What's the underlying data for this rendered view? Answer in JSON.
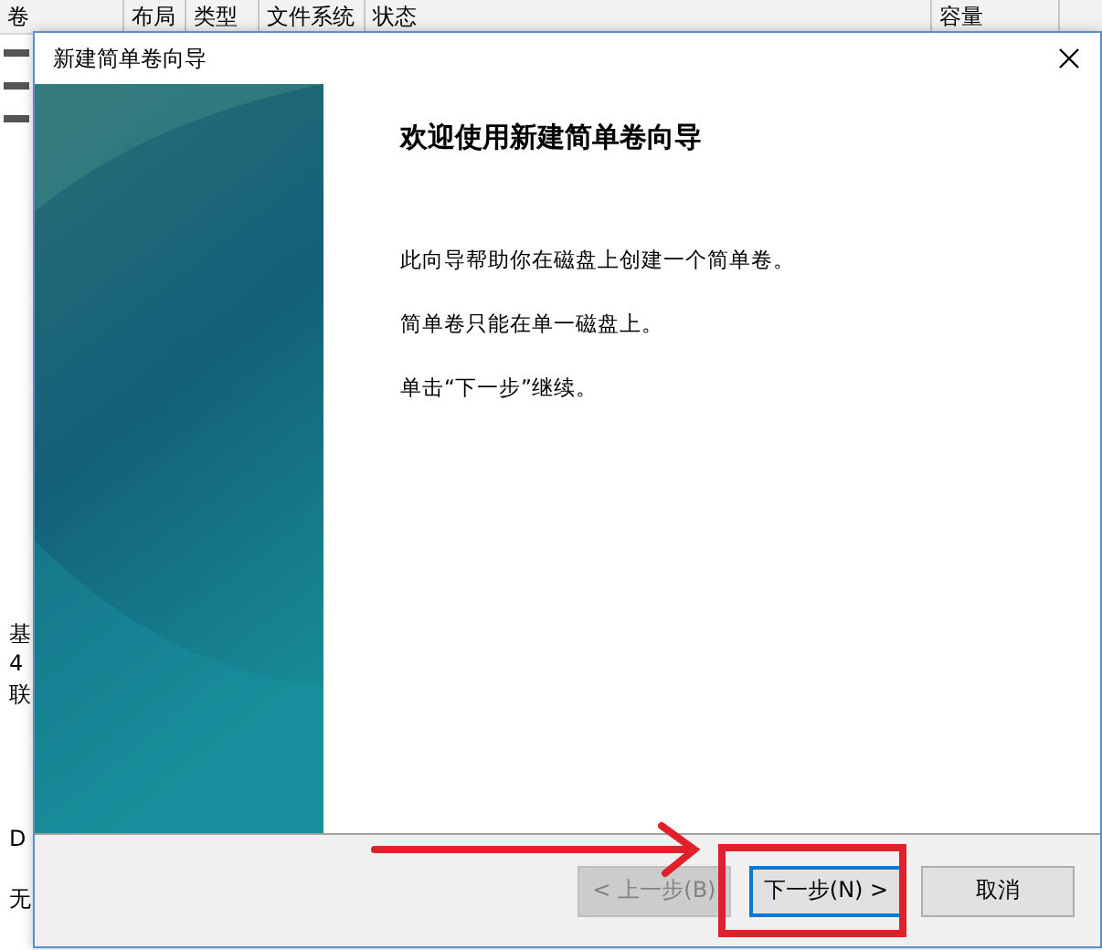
{
  "background_window": {
    "columns": [
      "卷",
      "布局",
      "类型",
      "文件系统",
      "状态",
      "容量"
    ],
    "disk_fragments": [
      {
        "text": "基"
      },
      {
        "text": "4"
      },
      {
        "text": "联"
      },
      {
        "text": "D"
      },
      {
        "text": "无"
      }
    ]
  },
  "dialog": {
    "title": "新建简单卷向导",
    "heading": "欢迎使用新建简单卷向导",
    "paragraphs": [
      "此向导帮助你在磁盘上创建一个简单卷。",
      "简单卷只能在单一磁盘上。",
      "单击“下一步”继续。"
    ],
    "buttons": [
      {
        "label": "< 上一步(B)",
        "disabled": true,
        "selected": false
      },
      {
        "label": "下一步(N) >",
        "disabled": false,
        "selected": true
      },
      {
        "label": "取消",
        "disabled": false,
        "selected": false
      }
    ]
  }
}
